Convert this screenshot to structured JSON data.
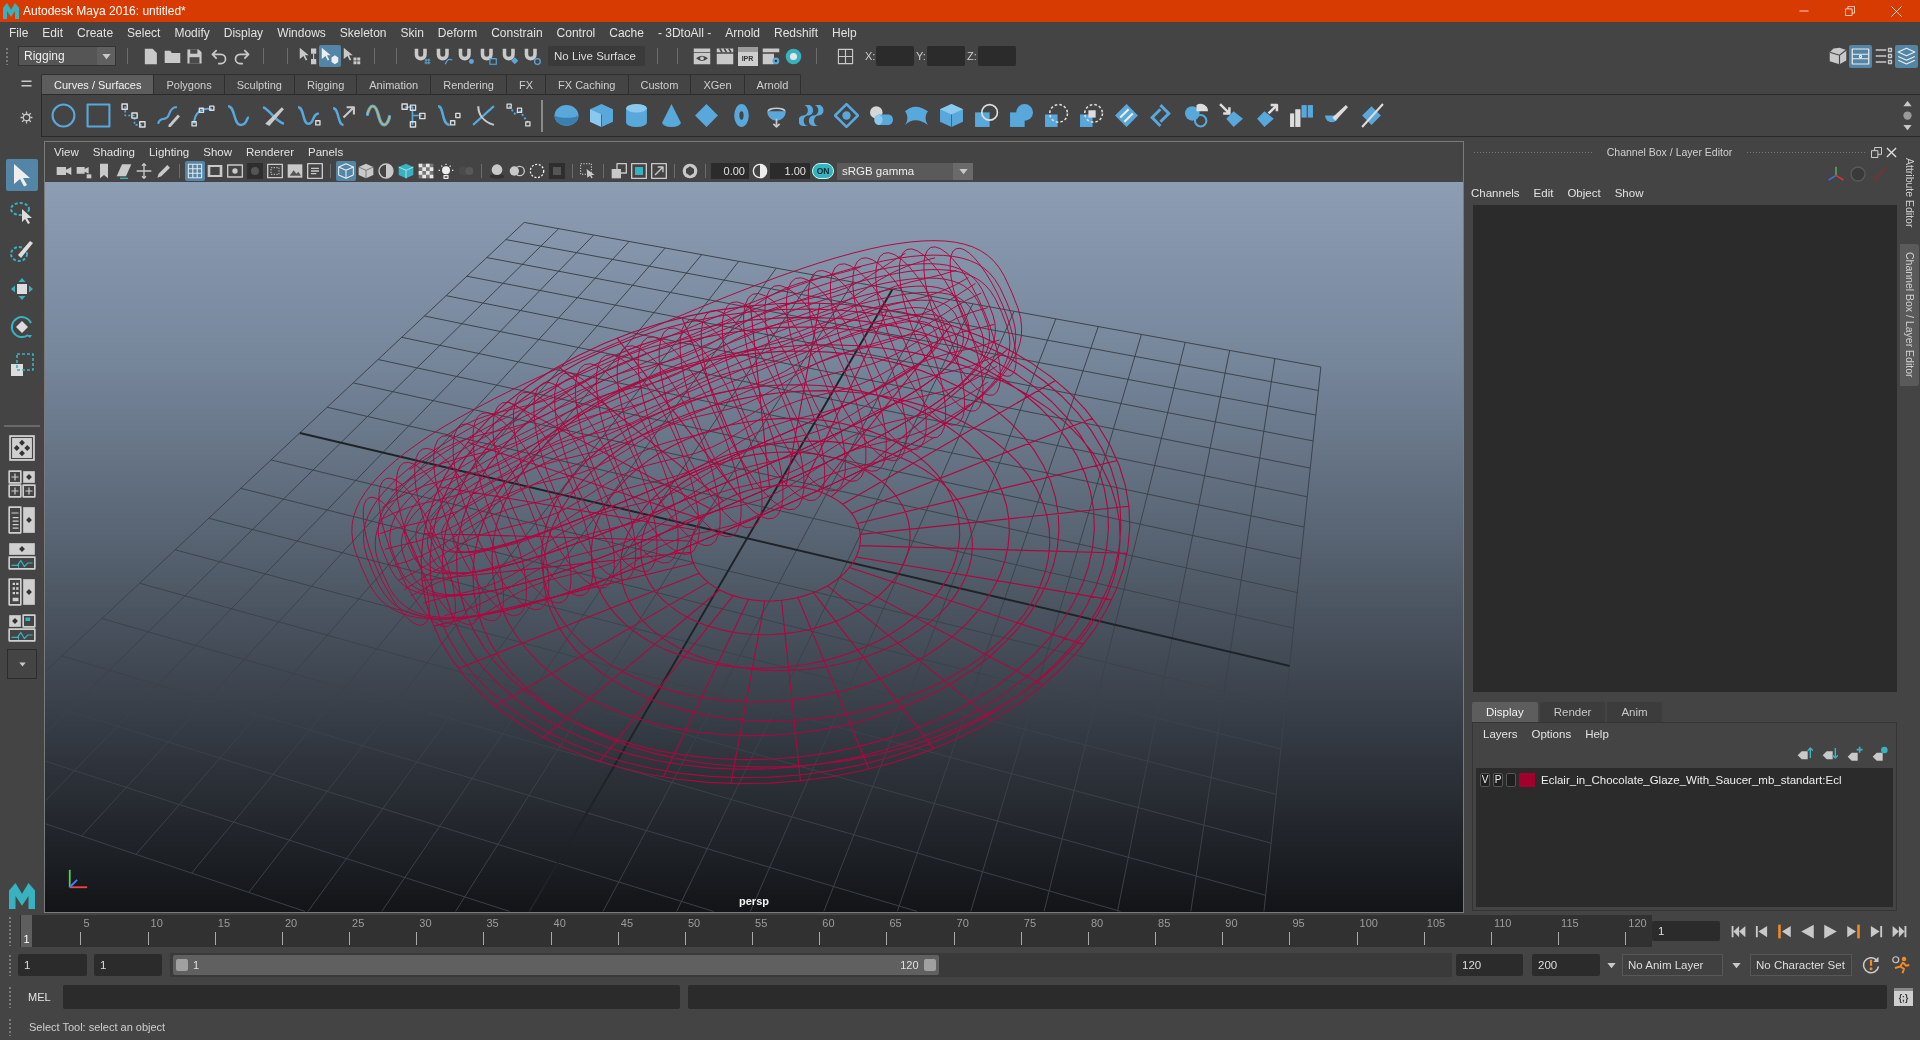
{
  "window": {
    "title": "Autodesk Maya 2016: untitled*"
  },
  "menu_bar": [
    "File",
    "Edit",
    "Create",
    "Select",
    "Modify",
    "Display",
    "Windows",
    "Skeleton",
    "Skin",
    "Deform",
    "Constrain",
    "Control",
    "Cache",
    "- 3DtoAll -",
    "Arnold",
    "Redshift",
    "Help"
  ],
  "status_line": {
    "menu_set": "Rigging",
    "selection_modes": [
      {
        "selected": false
      },
      {
        "selected": true
      },
      {
        "selected": false
      }
    ],
    "live_surface": "No Live Surface",
    "ipr_label": "IPR",
    "coordinates": [
      {
        "label": "X:"
      },
      {
        "label": "Y:"
      },
      {
        "label": "Z:"
      }
    ],
    "panel_toggles": [
      {
        "on": false
      },
      {
        "on": true
      },
      {
        "on": false
      },
      {
        "on": true
      }
    ]
  },
  "shelf": {
    "tabs": [
      {
        "label": "Curves / Surfaces",
        "selected": true
      },
      {
        "label": "Polygons",
        "selected": false
      },
      {
        "label": "Sculpting",
        "selected": false
      },
      {
        "label": "Rigging",
        "selected": false
      },
      {
        "label": "Animation",
        "selected": false
      },
      {
        "label": "Rendering",
        "selected": false
      },
      {
        "label": "FX",
        "selected": false
      },
      {
        "label": "FX Caching",
        "selected": false
      },
      {
        "label": "Custom",
        "selected": false
      },
      {
        "label": "XGen",
        "selected": false
      },
      {
        "label": "Arnold",
        "selected": false
      }
    ]
  },
  "toolbox": {
    "tools": [
      {
        "selected": true
      },
      {
        "selected": false
      },
      {
        "selected": false
      },
      {
        "selected": false
      },
      {
        "selected": false
      },
      {
        "selected": false
      }
    ]
  },
  "viewport": {
    "menu": [
      "View",
      "Shading",
      "Lighting",
      "Show",
      "Renderer",
      "Panels"
    ],
    "toolbar": [
      {
        "on": false
      },
      {
        "on": false
      },
      {
        "on": false
      },
      {
        "on": false
      },
      {
        "on": false
      },
      {
        "on": false
      },
      {
        "on": true
      },
      {
        "on": false
      },
      {
        "on": false
      },
      {
        "on": false
      },
      {
        "on": false
      },
      {
        "on": false
      },
      {
        "on": false
      },
      {
        "on": true
      },
      {
        "on": false
      },
      {
        "on": false
      },
      {
        "on": false
      },
      {
        "on": false
      },
      {
        "on": false
      },
      {
        "on": false
      },
      {
        "on": false
      },
      {
        "on": false
      },
      {
        "on": false
      },
      {
        "on": false
      },
      {
        "on": false
      },
      {
        "on": false
      },
      {
        "on": false
      },
      {
        "on": false
      },
      {
        "on": false
      },
      {
        "on": false
      }
    ],
    "exposure": "0.00",
    "gamma": "1.00",
    "color_management": "ON",
    "view_transform": "sRGB gamma",
    "camera": "persp"
  },
  "channel_box": {
    "title": "Channel Box / Layer Editor",
    "menu": [
      "Channels",
      "Edit",
      "Object",
      "Show"
    ]
  },
  "layer_editor": {
    "tabs": [
      {
        "label": "Display",
        "selected": true
      },
      {
        "label": "Render",
        "selected": false
      },
      {
        "label": "Anim",
        "selected": false
      }
    ],
    "menu": [
      "Layers",
      "Options",
      "Help"
    ],
    "layers": [
      {
        "visibility": "V",
        "playback": "P",
        "color": "#a3002e",
        "name": "Eclair_in_Chocolate_Glaze_With_Saucer_mb_standart:Ecl"
      }
    ]
  },
  "side_tabs": [
    {
      "label": "Attribute Editor",
      "selected": false
    },
    {
      "label": "Channel Box / Layer Editor",
      "selected": true
    }
  ],
  "time_slider": {
    "ticks": [
      "5",
      "10",
      "15",
      "20",
      "25",
      "30",
      "35",
      "40",
      "45",
      "50",
      "55",
      "60",
      "65",
      "70",
      "75",
      "80",
      "85",
      "90",
      "95",
      "100",
      "105",
      "110",
      "115",
      "120"
    ],
    "current_frame": "1",
    "level": 0,
    "frame_field": "1"
  },
  "range_slider": {
    "start": "1",
    "playback_start": "1",
    "bar_start": "1",
    "bar_end": "120",
    "level": 0.6,
    "playback_end": "120",
    "end": "200",
    "anim_layer": "No Anim Layer",
    "character_set": "No Character Set"
  },
  "command_line": {
    "language": "MEL",
    "script_editor": "{;}"
  },
  "help_line": "Select Tool: select an object"
}
